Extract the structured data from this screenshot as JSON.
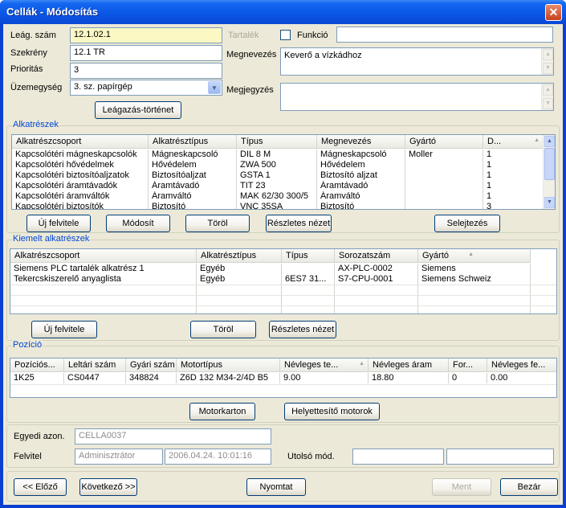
{
  "window": {
    "title": "Cellák - Módosítás",
    "close": "✕"
  },
  "form": {
    "leag_szam": {
      "label": "Leág. szám",
      "value": "12.1.02.1"
    },
    "szekreny": {
      "label": "Szekrény",
      "value": "12.1 TR"
    },
    "prioritas": {
      "label": "Prioritás",
      "value": "3"
    },
    "uzemegyseg": {
      "label": "Üzemegység",
      "value": "3. sz. papírgép"
    },
    "tartalek": {
      "label": "Tartalék"
    },
    "funkcio": {
      "label": "Funkció",
      "value": ""
    },
    "megnevezes": {
      "label": "Megnevezés",
      "value": "Keverő a vízkádhoz"
    },
    "megjegyzes": {
      "label": "Megjegyzés",
      "value": ""
    },
    "leagazas_btn": "Leágazás-történet"
  },
  "alkatreszek": {
    "title": "Alkatrészek",
    "columns": [
      "Alkatrészcsoport",
      "Alkatrésztípus",
      "Típus",
      "Megnevezés",
      "Gyártó",
      "D..."
    ],
    "rows": [
      [
        "Kapcsolótéri mágneskapcsolók",
        "Mágneskapcsoló",
        "DIL 8 M",
        "Mágneskapcsoló",
        "Moller",
        "1"
      ],
      [
        "Kapcsolótéri hővédelmek",
        "Hővédelem",
        "ZWA 500",
        "Hővédelem",
        "",
        "1"
      ],
      [
        "Kapcsolótéri biztosítóaljzatok",
        "Biztosítóaljzat",
        "GSTA 1",
        "Biztosító aljzat",
        "",
        "1"
      ],
      [
        "Kapcsolótéri áramtávadók",
        "Áramtávadó",
        "TIT 23",
        "Áramtávadó",
        "",
        "1"
      ],
      [
        "Kapcsolótéri áramváltók",
        "Áramváltó",
        "MAK 62/30 300/5",
        "Áramváltó",
        "",
        "1"
      ],
      [
        "Kapcsolótéri biztosítók",
        "Biztosító",
        "VNC 35SA",
        "Biztosító",
        "",
        "3"
      ]
    ],
    "buttons": {
      "new": "Új felvitele",
      "edit": "Módosít",
      "delete": "Töröl",
      "details": "Részletes nézet",
      "scrap": "Selejtezés"
    }
  },
  "kiemelt": {
    "title": "Kiemelt alkatrészek",
    "columns": [
      "Alkatrészcsoport",
      "Alkatrésztípus",
      "Típus",
      "Sorozatszám",
      "Gyártó"
    ],
    "rows": [
      [
        "Siemens PLC tartalék alkatrész 1",
        "Egyéb",
        "",
        "AX-PLC-0002",
        "Siemens"
      ],
      [
        "Tekercskiszerelő anyaglista",
        "Egyéb",
        "6ES7 31...",
        "S7-CPU-0001",
        "Siemens Schweiz"
      ]
    ],
    "buttons": {
      "new": "Új felvitele",
      "delete": "Töröl",
      "details": "Részletes nézet"
    }
  },
  "pozicio": {
    "title": "Pozíció",
    "columns": [
      "Pozíciós...",
      "Leltári szám",
      "Gyári szám",
      "Motortípus",
      "Névleges te...",
      "Névleges áram",
      "For...",
      "Névleges fe..."
    ],
    "rows": [
      [
        "1K25",
        "CS0447",
        "348824",
        "Z6D 132 M34-2/4D B5",
        "9.00",
        "18.80",
        "0",
        "0.00"
      ]
    ],
    "buttons": {
      "motorkarton": "Motorkarton",
      "helyettesito": "Helyettesítő motorok"
    }
  },
  "meta": {
    "egyedi_label": "Egyedi azon.",
    "egyedi_value": "CELLA0037",
    "felvitel_label": "Felvitel",
    "felvitel_user": "Adminisztrátor",
    "felvitel_date": "2006.04.24. 10:01:16",
    "utolso_label": "Utolsó mód.",
    "utolso_user": "",
    "utolso_date": ""
  },
  "footer": {
    "prev": "<< Előző",
    "next": "Következő >>",
    "print": "Nyomtat",
    "save": "Ment",
    "close": "Bezár"
  },
  "colors": {
    "titlebar": "#0a56e6",
    "group_title": "#0046d5",
    "yellow_field": "#fcf8c4"
  }
}
